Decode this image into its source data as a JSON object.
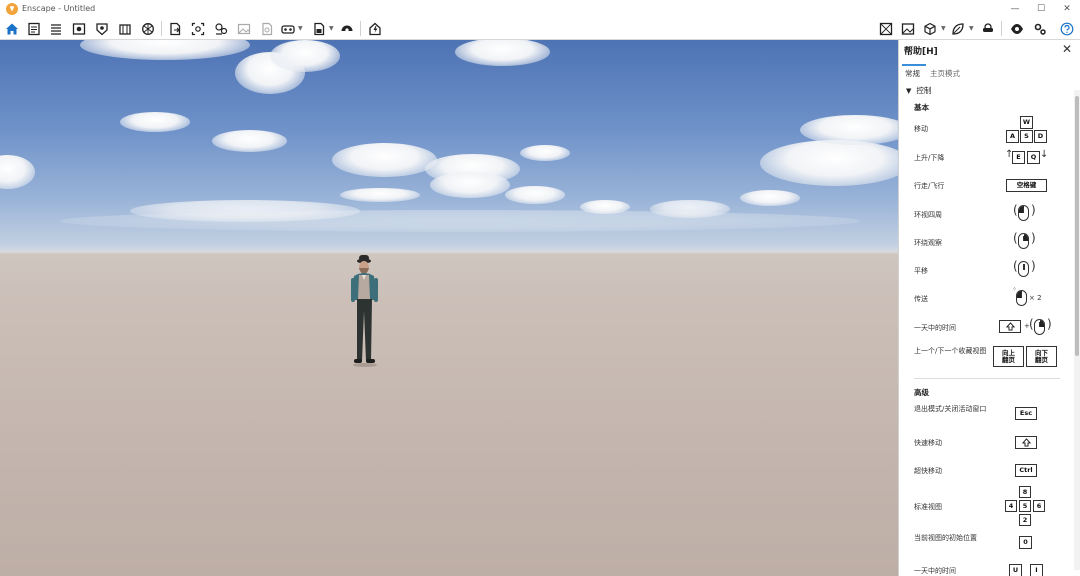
{
  "window": {
    "title": "Enscape - Untitled",
    "minimize": "—",
    "maximize": "☐",
    "close": "✕"
  },
  "toolbar": {
    "icons": [
      "home-icon",
      "document-icon",
      "settings-list-icon",
      "visual-settings-icon",
      "asset-library-icon",
      "library-icon",
      "materials-icon",
      "export-icon",
      "screenshot-icon",
      "video-icon",
      "image-icon",
      "panorama-icon",
      "vr-icon",
      "web-export-icon",
      "sync-icon",
      "views-icon",
      "walk-icon",
      "fly-icon",
      "visibility-icon",
      "gear-icon",
      "help-icon"
    ],
    "accent": "#1a73c8"
  },
  "help": {
    "title": "帮助[H]",
    "tabs": [
      "常规",
      "主页模式"
    ],
    "section": "控制",
    "basic": {
      "title": "基本",
      "rows": [
        {
          "label": "移动",
          "keys": [
            "W",
            "A",
            "S",
            "D"
          ]
        },
        {
          "label": "上升/下降",
          "keys": [
            "E",
            "Q"
          ]
        },
        {
          "label": "行走/飞行",
          "keys": [
            "空格键"
          ]
        },
        {
          "label": "环视四周"
        },
        {
          "label": "环绕观察"
        },
        {
          "label": "平移"
        },
        {
          "label": "传送",
          "suffix": "× 2"
        },
        {
          "label": "一天中的时间",
          "joiner": "+"
        },
        {
          "label": "上一个/下一个收藏视图",
          "keys": [
            "向上\n翻页",
            "向下\n翻页"
          ]
        }
      ]
    },
    "advanced": {
      "title": "高级",
      "rows": [
        {
          "label": "退出模式/关闭活动窗口",
          "keys": [
            "Esc"
          ]
        },
        {
          "label": "快速移动"
        },
        {
          "label": "超快移动",
          "keys": [
            "Ctrl"
          ]
        },
        {
          "label": "标准视图",
          "keys": [
            "8",
            "4",
            "5",
            "6",
            "2"
          ]
        },
        {
          "label": "当前视图的初始位置",
          "keys": [
            "0"
          ]
        },
        {
          "label": "一天中的时间",
          "keys": [
            "U",
            "I"
          ]
        }
      ]
    }
  }
}
